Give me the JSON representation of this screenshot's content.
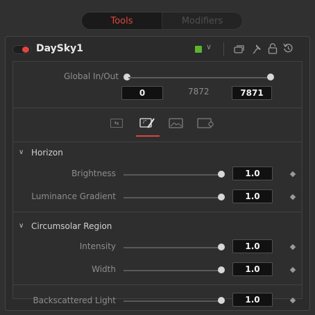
{
  "tabs": [
    {
      "label": "Tools",
      "active": true
    },
    {
      "label": "Modifiers",
      "active": false
    }
  ],
  "node": {
    "title": "DaySky1",
    "enabled": true,
    "color_swatch": "#5cb531",
    "header_icons": [
      "chevron-down-icon",
      "versions-icon",
      "pin-icon",
      "lock-icon",
      "reset-icon"
    ]
  },
  "global": {
    "label": "Global In/Out",
    "in_value": "0",
    "mid_value": "7872",
    "out_value": "7871"
  },
  "subtabs": [
    "controls-icon",
    "magic-wand-icon",
    "image-icon",
    "settings-icon"
  ],
  "sections": {
    "horizon": {
      "title": "Horizon",
      "params": [
        {
          "label": "Brightness",
          "value": "1.0"
        },
        {
          "label": "Luminance Gradient",
          "value": "1.0"
        }
      ]
    },
    "circumsolar": {
      "title": "Circumsolar Region",
      "params": [
        {
          "label": "Intensity",
          "value": "1.0"
        },
        {
          "label": "Width",
          "value": "1.0"
        }
      ]
    },
    "backscatter": {
      "label": "Backscattered Light",
      "value": "1.0"
    }
  },
  "colors": {
    "accent_red": "#e0463f",
    "panel_bg": "#2e2e2e",
    "field_bg": "#111111"
  }
}
